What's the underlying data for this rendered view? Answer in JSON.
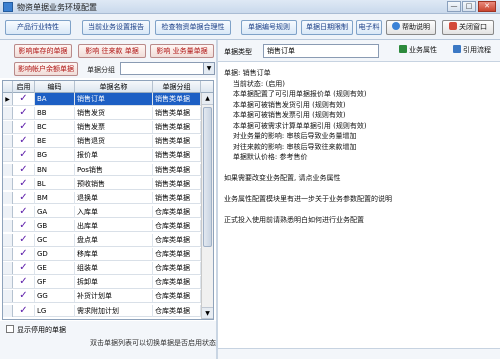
{
  "window": {
    "title": "物资单据业务环境配置"
  },
  "toolbar": {
    "buttons": [
      "产品行业特性",
      "当前业务设置报告",
      "检查物资单据合理性",
      "单据编号规则",
      "单据日期限制",
      "电子料",
      "帮助说明",
      "关闭窗口"
    ]
  },
  "actions": {
    "buttons": [
      "影响库存的单据",
      "影响 往来款 单据",
      "影响 业务量单据",
      "影响帐户余额单据"
    ],
    "group_label": "单据分组",
    "group_value": ""
  },
  "grid": {
    "headers": {
      "enabled": "启用",
      "code": "编码",
      "name": "单据名称",
      "group": "单据分组"
    },
    "rows": [
      {
        "code": "BA",
        "name": "销售订单",
        "group": "销售类单据"
      },
      {
        "code": "BB",
        "name": "销售发货",
        "group": "销售类单据"
      },
      {
        "code": "BC",
        "name": "销售发票",
        "group": "销售类单据"
      },
      {
        "code": "BE",
        "name": "销售退货",
        "group": "销售类单据"
      },
      {
        "code": "BG",
        "name": "报价单",
        "group": "销售类单据"
      },
      {
        "code": "BN",
        "name": "Pos销售",
        "group": "销售类单据"
      },
      {
        "code": "BL",
        "name": "预收销售",
        "group": "销售类单据"
      },
      {
        "code": "BM",
        "name": "退换单",
        "group": "销售类单据"
      },
      {
        "code": "GA",
        "name": "入库单",
        "group": "仓库类单据"
      },
      {
        "code": "GB",
        "name": "出库单",
        "group": "仓库类单据"
      },
      {
        "code": "GC",
        "name": "盘点单",
        "group": "仓库类单据"
      },
      {
        "code": "GD",
        "name": "移库单",
        "group": "仓库类单据"
      },
      {
        "code": "GE",
        "name": "组装单",
        "group": "仓库类单据"
      },
      {
        "code": "GF",
        "name": "拆卸单",
        "group": "仓库类单据"
      },
      {
        "code": "GG",
        "name": "补货计划单",
        "group": "仓库类单据"
      },
      {
        "code": "LG",
        "name": "需求附加计划",
        "group": "仓库类单据"
      }
    ]
  },
  "footer": {
    "show_disabled_label": "显示停用的单据",
    "hint": "双击单据列表可以切换单据是否启用状态"
  },
  "detail": {
    "type_label": "单据类型",
    "type_value": "销售订单",
    "props_button": "业务属性",
    "flow_button": "引用流程",
    "lines": [
      "单据: 销售订单",
      "    当前状态: (启用)",
      "    本单据配置了可引用单据报价单 (规则有效)",
      "    本单据可被销售发货引用 (规则有效)",
      "    本单据可被销售发票引用 (规则有效)",
      "    本单据可被需求计算单单据引用 (规则有效)",
      "    对业务量的影响: 审核后导致业务量增加",
      "    对往来款的影响: 审核后导致往来款增加",
      "    单据默认价格: 参考售价",
      "",
      "如果需要改变业务配置, 请点业务属性",
      "",
      "业务属性配置模块里有进一步关于业务参数配置的说明",
      "",
      "正式投入使用前请熟悉明白如何进行业务配置"
    ]
  },
  "colors": {
    "selection": "#1d5fc4",
    "check": "#5a1aa8",
    "action_text": "#b01515"
  }
}
